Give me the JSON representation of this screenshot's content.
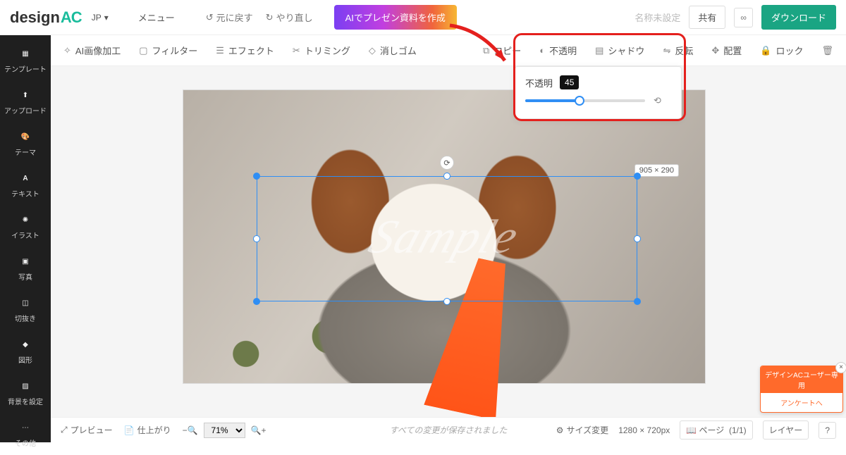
{
  "header": {
    "logo_prefix": "design",
    "logo_suffix": "AC",
    "lang": "JP",
    "menu": "メニュー",
    "undo": "元に戻す",
    "redo": "やり直し",
    "ai_button": "AIでプレゼン資料を作成",
    "name_placeholder": "名称未設定",
    "share": "共有",
    "download": "ダウンロード"
  },
  "sidebar": {
    "items": [
      {
        "label": "テンプレート"
      },
      {
        "label": "アップロード"
      },
      {
        "label": "テーマ"
      },
      {
        "label": "テキスト"
      },
      {
        "label": "イラスト"
      },
      {
        "label": "写真"
      },
      {
        "label": "切抜き"
      },
      {
        "label": "図形"
      },
      {
        "label": "背景を設定"
      }
    ],
    "more": "その他"
  },
  "subbar": {
    "left": [
      {
        "label": "AI画像加工"
      },
      {
        "label": "フィルター"
      },
      {
        "label": "エフェクト"
      },
      {
        "label": "トリミング"
      },
      {
        "label": "消しゴム"
      }
    ],
    "right": [
      {
        "label": "コピー"
      },
      {
        "label": "不透明"
      },
      {
        "label": "シャドウ"
      },
      {
        "label": "反転"
      },
      {
        "label": "配置"
      },
      {
        "label": "ロック"
      }
    ]
  },
  "popover": {
    "label": "不透明",
    "value": "45",
    "percent": 45
  },
  "canvas": {
    "watermark": "Sample",
    "selection_size": "905 × 290"
  },
  "bottombar": {
    "preview": "プレビュー",
    "finishing": "仕上がり",
    "zoom": "71%",
    "saved_msg": "すべての変更が保存されました",
    "resize": "サイズ変更",
    "canvas_size": "1280 × 720px",
    "page_label": "ページ",
    "page_count": "(1/1)",
    "layer": "レイヤー"
  },
  "survey": {
    "head": "デザインACユーザー専用",
    "body": "アンケートへ"
  }
}
